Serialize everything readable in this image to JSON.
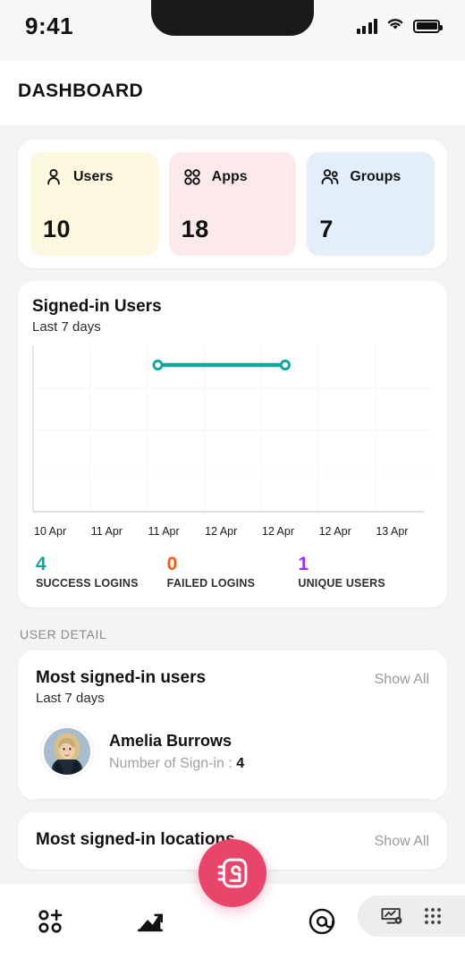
{
  "status_bar": {
    "time": "9:41",
    "signal_icon": "signal-bars-icon",
    "wifi_icon": "wifi-icon",
    "battery_icon": "battery-icon"
  },
  "header": {
    "title": "DASHBOARD"
  },
  "stats": [
    {
      "label": "Users",
      "value": "10",
      "icon": "user-icon",
      "bg": "#FBF8DF"
    },
    {
      "label": "Apps",
      "value": "18",
      "icon": "apps-grid-icon",
      "bg": "#FCE9EC"
    },
    {
      "label": "Groups",
      "value": "7",
      "icon": "groups-icon",
      "bg": "#E3EEFB"
    }
  ],
  "chart_card": {
    "title": "Signed-in Users",
    "subtitle": "Last 7 days"
  },
  "chart_data": {
    "type": "line",
    "title": "Signed-in Users",
    "subtitle": "Last 7 days",
    "xlabel": "",
    "ylabel": "",
    "categories": [
      "10 Apr",
      "11 Apr",
      "11 Apr",
      "12 Apr",
      "12 Apr",
      "12 Apr",
      "13 Apr"
    ],
    "tick_labels": [
      "10 Apr",
      "11 Apr",
      "11 Apr",
      "12 Apr",
      "12 Apr",
      "12 Apr",
      "13 Apr"
    ],
    "series": [
      {
        "name": "Signed-in Users",
        "color": "#0FA79B",
        "points": [
          {
            "x": 2,
            "label": "11 Apr",
            "y": 4
          },
          {
            "x": 4,
            "label": "12 Apr",
            "y": 4
          }
        ],
        "values": [
          null,
          null,
          4,
          4,
          4,
          null,
          null
        ]
      }
    ],
    "ylim": [
      0,
      5
    ],
    "grid": true,
    "legend": "none",
    "marker": "circle-open"
  },
  "metrics": [
    {
      "value": "4",
      "label": "SUCCESS LOGINS",
      "color": "#17A398"
    },
    {
      "value": "0",
      "label": "FAILED LOGINS",
      "color": "#F05A16"
    },
    {
      "value": "1",
      "label": "UNIQUE USERS",
      "color": "#9A2EFF"
    }
  ],
  "section": {
    "title": "USER DETAIL"
  },
  "users_card": {
    "title": "Most signed-in users",
    "subtitle": "Last 7 days",
    "show_all": "Show All",
    "rows": [
      {
        "name": "Amelia Burrows",
        "signins_label": "Number of Sign-in :",
        "signins_value": "4",
        "avatar": "user-photo-avatar"
      }
    ]
  },
  "locations_card": {
    "title": "Most signed-in locations",
    "show_all": "Show All"
  },
  "fab": {
    "icon": "contacts-book-icon",
    "color": "#E8456B"
  },
  "navbar": {
    "items": [
      {
        "icon": "apps-sparkle-icon",
        "name": "nav-apps"
      },
      {
        "icon": "trending-chart-icon",
        "name": "nav-reports"
      },
      {
        "icon": "at-circle-icon",
        "name": "nav-mentions"
      }
    ],
    "pill": [
      {
        "icon": "dashboard-settings-icon",
        "name": "nav-dashboard-settings"
      },
      {
        "icon": "grid-dots-icon",
        "name": "nav-app-grid"
      }
    ]
  }
}
